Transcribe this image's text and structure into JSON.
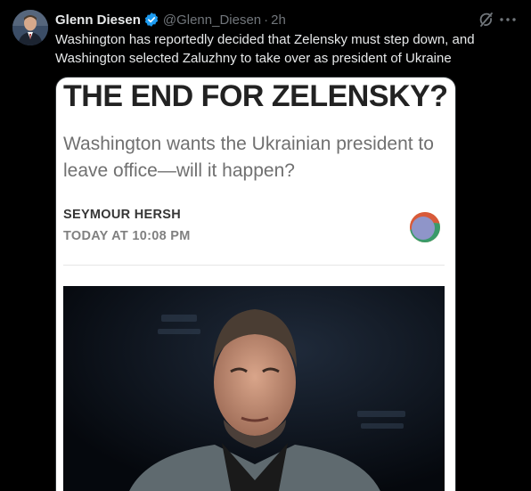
{
  "author": {
    "display_name": "Glenn Diesen",
    "handle": "@Glenn_Diesen",
    "separator": "·",
    "time_ago": "2h"
  },
  "tweet": {
    "text": "Washington has reportedly decided that Zelensky must step down, and Washington selected Zaluzhny to take over as president of Ukraine"
  },
  "card": {
    "title": "THE END FOR ZELENSKY?",
    "subtitle": "Washington wants the Ukrainian president to leave office—will it happen?",
    "byline": "SEYMOUR HERSH",
    "published": "TODAY AT 10:08 PM"
  },
  "icons": {
    "verified": "verified-badge-icon",
    "grok": "grok-icon",
    "more": "more-options-icon",
    "publication_logo": "publication-logo-icon"
  },
  "colors": {
    "background": "#000000",
    "primary_text": "#e7e9ea",
    "secondary_text": "#71767b",
    "verified_blue": "#1d9bf0",
    "card_background": "#ffffff"
  }
}
